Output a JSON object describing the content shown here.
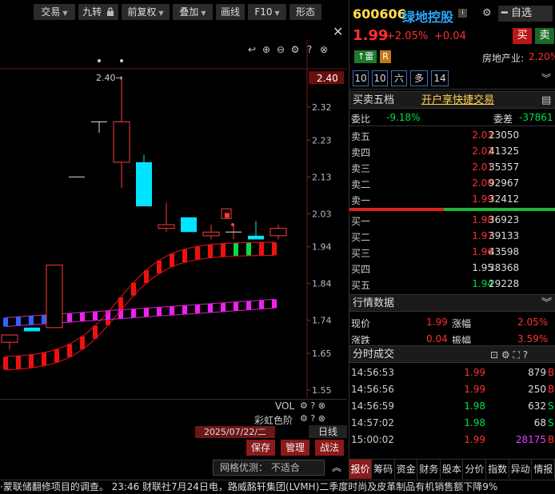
{
  "toolbar": {
    "buttons": [
      {
        "label": "交易",
        "arrow": "▼"
      },
      {
        "label": "九转",
        "icon": "lock-icon"
      },
      {
        "label": "前复权",
        "arrow": "▼"
      },
      {
        "label": "叠加",
        "arrow": "▼"
      },
      {
        "label": "画线"
      },
      {
        "label": "F10",
        "arrow": "▼"
      },
      {
        "label": "形态"
      }
    ],
    "close": "✕"
  },
  "chart": {
    "high_label": "2.40",
    "current_price_tag": "2.40",
    "marker_label": "■",
    "y_ticks": [
      "2.32",
      "2.23",
      "2.13",
      "2.03",
      "1.94",
      "1.84",
      "1.74",
      "1.65",
      "1.55"
    ],
    "vol_label": "VOL",
    "rainbow_label": "彩虹色阶",
    "date": "2025/07/22/二",
    "period": "日线"
  },
  "chart_data": {
    "type": "candlestick",
    "ylim": [
      1.55,
      2.42
    ],
    "candles": [
      {
        "o": 1.68,
        "h": 1.7,
        "l": 1.66,
        "c": 1.7,
        "up": true
      },
      {
        "o": 1.71,
        "h": 1.72,
        "l": 1.71,
        "c": 1.72,
        "up": false
      },
      {
        "o": 1.72,
        "h": 1.89,
        "l": 1.72,
        "c": 1.89,
        "up": true
      },
      {
        "o": 2.13,
        "h": 2.13,
        "l": 2.13,
        "c": 2.13,
        "up": false
      },
      {
        "o": 2.28,
        "h": 2.28,
        "l": 2.25,
        "c": 2.28,
        "up": false
      },
      {
        "o": 2.17,
        "h": 2.4,
        "l": 2.1,
        "c": 2.28,
        "up": true
      },
      {
        "o": 2.17,
        "h": 2.19,
        "l": 2.05,
        "c": 2.05,
        "up": false
      },
      {
        "o": 2.0,
        "h": 2.06,
        "l": 1.98,
        "c": 1.99,
        "up": true
      },
      {
        "o": 2.02,
        "h": 2.02,
        "l": 1.98,
        "c": 1.98,
        "up": false
      },
      {
        "o": 1.97,
        "h": 2.0,
        "l": 1.96,
        "c": 1.98,
        "up": true
      },
      {
        "o": 1.98,
        "h": 2.0,
        "l": 1.96,
        "c": 1.98,
        "up": true
      },
      {
        "o": 1.97,
        "h": 2.01,
        "l": 1.96,
        "c": 1.96,
        "up": false
      },
      {
        "o": 1.97,
        "h": 2.0,
        "l": 1.96,
        "c": 1.99,
        "up": true
      }
    ]
  },
  "quote": {
    "code": "600606",
    "name": "绿地控股",
    "info_icon": "i",
    "watch": "自选",
    "price": "1.99",
    "change_pct": "+2.05%",
    "change": "+0.04",
    "buy": "买",
    "sell": "卖",
    "tag_thunder": "雷",
    "tag_r": "R",
    "industry": "房地产业:",
    "industry_pct": "2.20%",
    "tabs": [
      "10",
      "10",
      "六",
      "多",
      "14"
    ]
  },
  "orderbook": {
    "title": "买卖五档",
    "link": "开户享快捷交易",
    "ratio_label": "委比",
    "ratio": "-9.18%",
    "diff_label": "委差",
    "diff": "-37861",
    "asks": [
      {
        "name": "卖五",
        "price": "2.03",
        "vol": "23050"
      },
      {
        "name": "卖四",
        "price": "2.02",
        "vol": "41325"
      },
      {
        "name": "卖三",
        "price": "2.01",
        "vol": "35357"
      },
      {
        "name": "卖二",
        "price": "2.00",
        "vol": "92967"
      },
      {
        "name": "卖一",
        "price": "1.99",
        "vol": "32412"
      }
    ],
    "bids": [
      {
        "name": "买一",
        "price": "1.98",
        "vol": "36923"
      },
      {
        "name": "买二",
        "price": "1.97",
        "vol": "39133"
      },
      {
        "name": "买三",
        "price": "1.96",
        "vol": "43598"
      },
      {
        "name": "买四",
        "price": "1.95",
        "vol": "38368"
      },
      {
        "name": "买五",
        "price": "1.94",
        "vol": "29228"
      }
    ]
  },
  "market": {
    "title": "行情数据",
    "row1_l": "现价",
    "row1_lv": "1.99",
    "row1_r": "涨幅",
    "row1_rv": "2.05%",
    "row2_l": "涨跌",
    "row2_lv": "0.04",
    "row2_r": "振幅",
    "row2_rv": "3.59%"
  },
  "trades": {
    "title": "分时成交",
    "rows": [
      {
        "t": "14:56:53",
        "p": "1.99",
        "v": "879",
        "d": "B"
      },
      {
        "t": "14:56:56",
        "p": "1.99",
        "v": "250",
        "d": "B"
      },
      {
        "t": "14:56:59",
        "p": "1.98",
        "v": "632",
        "d": "S"
      },
      {
        "t": "14:57:02",
        "p": "1.98",
        "v": "68",
        "d": "S"
      },
      {
        "t": "15:00:02",
        "p": "1.99",
        "v": "28175",
        "d": "B"
      }
    ]
  },
  "actions": {
    "save": "保存",
    "manage": "管理",
    "battle": "战法"
  },
  "network": "网格优测：  不适合",
  "bottom_tabs": [
    "报价",
    "筹码",
    "资金",
    "财务",
    "股本",
    "分价",
    "指数",
    "异动",
    "情报"
  ],
  "ticker": "·蒙联储翻修项目的调查。     23:46  财联社7月24日电，路威酩轩集团(LVMH)二季度时尚及皮革制品有机销售额下降9%"
}
